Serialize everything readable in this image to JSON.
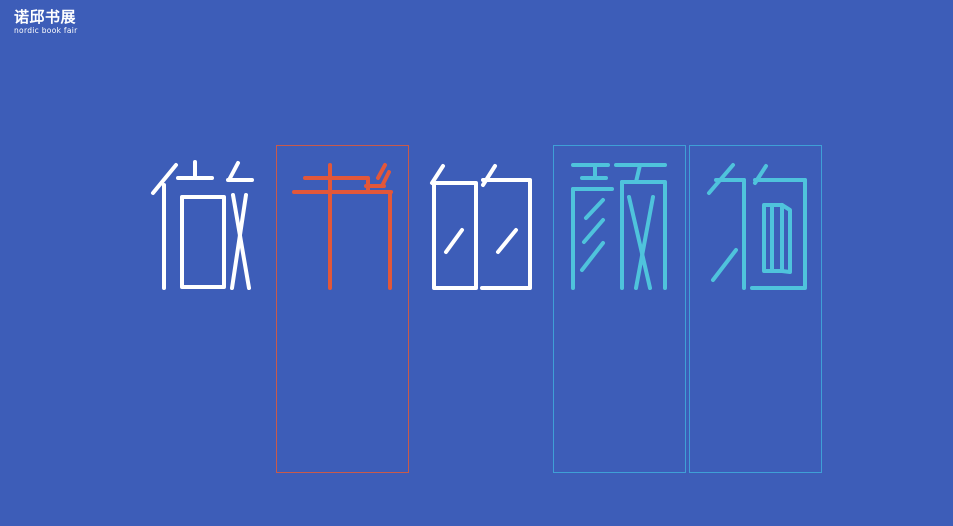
{
  "brand": {
    "title": "诺邱书展",
    "subtitle": "nordic book fair"
  },
  "headline": {
    "characters": [
      "做",
      "书",
      "的",
      "颜",
      "值"
    ]
  },
  "colors": {
    "background": "#3d5db8",
    "white": "#ffffff",
    "accent_orange": "#e2573a",
    "accent_cyan": "#4fc3dc",
    "guide_red": "#c85a4a",
    "guide_cyan": "#3f9fd6"
  }
}
